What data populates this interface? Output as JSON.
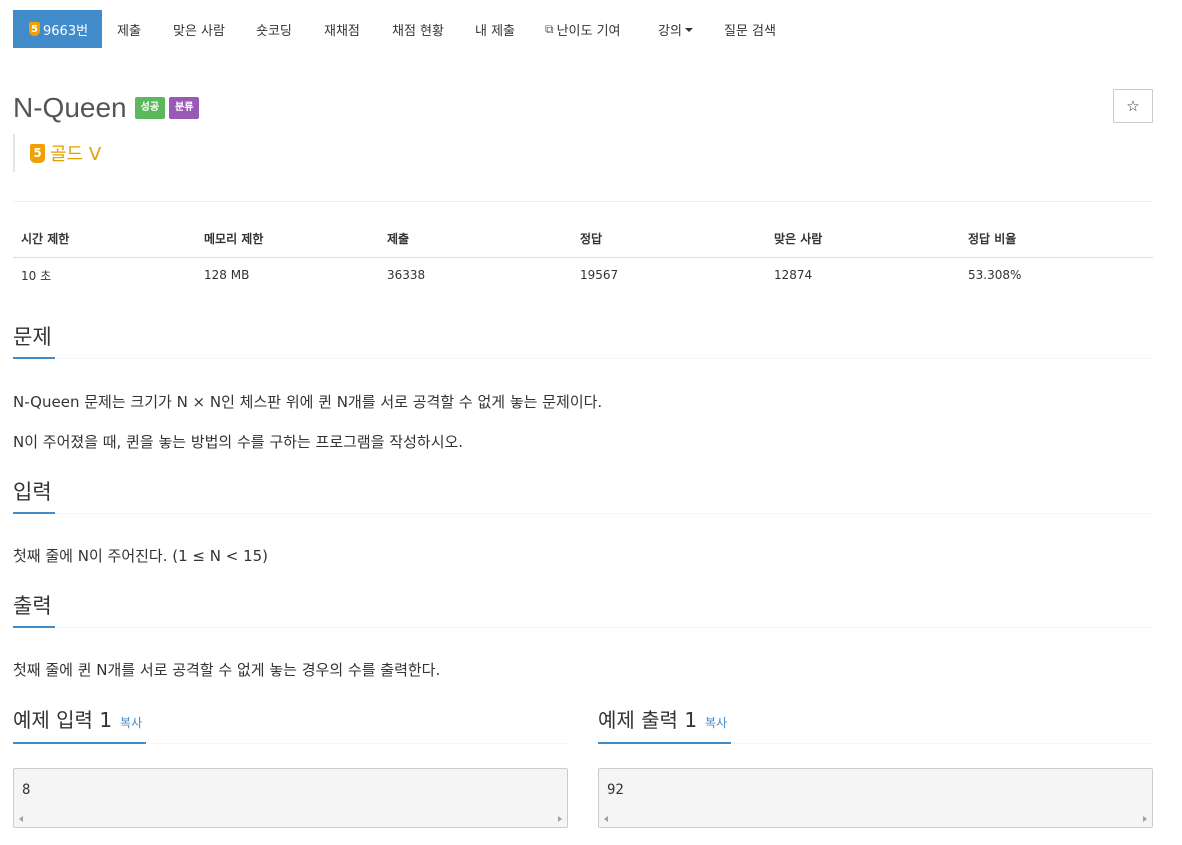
{
  "nav": {
    "problem_tier": "5",
    "problem_id": "9663번",
    "items": [
      "제출",
      "맞은 사람",
      "숏코딩",
      "재채점",
      "채점 현황",
      "내 제출",
      "난이도 기여",
      "강의",
      "질문 검색"
    ]
  },
  "problem": {
    "title": "N-Queen",
    "labels": [
      "성공",
      "분류"
    ],
    "tier_num": "5",
    "tier_text": "골드 V",
    "star": "☆"
  },
  "stats": {
    "headers": [
      "시간 제한",
      "메모리 제한",
      "제출",
      "정답",
      "맞은 사람",
      "정답 비율"
    ],
    "values": [
      "10 초",
      "128 MB",
      "36338",
      "19567",
      "12874",
      "53.308%"
    ]
  },
  "sections": {
    "description": {
      "heading": "문제",
      "paragraphs": [
        "N-Queen 문제는 크기가 N × N인 체스판 위에 퀸 N개를 서로 공격할 수 없게 놓는 문제이다.",
        "N이 주어졌을 때, 퀸을 놓는 방법의 수를 구하는 프로그램을 작성하시오."
      ]
    },
    "input": {
      "heading": "입력",
      "text": "첫째 줄에 N이 주어진다. (1 ≤ N < 15)"
    },
    "output": {
      "heading": "출력",
      "text": "첫째 줄에 퀸 N개를 서로 공격할 수 없게 놓는 경우의 수를 출력한다."
    }
  },
  "samples": [
    {
      "heading": "예제 입력 1",
      "copy": "복사",
      "value": "8"
    },
    {
      "heading": "예제 출력 1",
      "copy": "복사",
      "value": "92"
    }
  ],
  "colors": {
    "primary": "#428bca",
    "success": "#5cb85c",
    "purple": "#9b59b6",
    "gold": "#e0a000"
  }
}
